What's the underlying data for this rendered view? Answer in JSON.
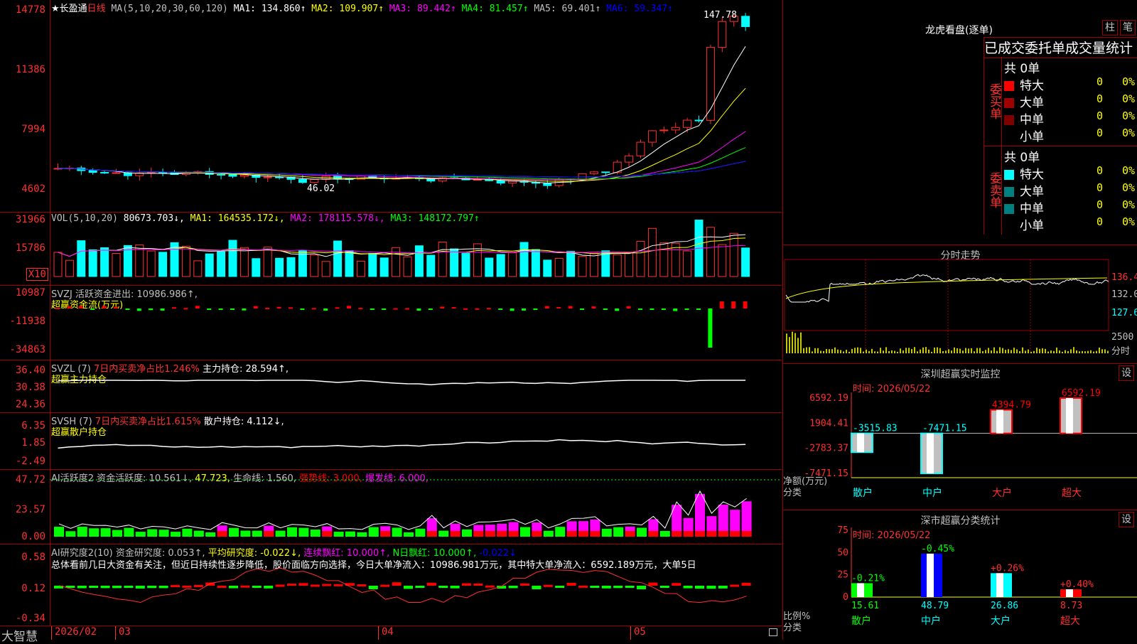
{
  "main": {
    "title": "★长盈通",
    "period": "日线",
    "ma_params": "MA(5,10,20,30,60,120)",
    "ma": [
      {
        "label": "MA1: 134.860↑",
        "color": "#ffffff"
      },
      {
        "label": "MA2: 109.907↑",
        "color": "#ffff00"
      },
      {
        "label": "MA3: 89.442↑",
        "color": "#ff00ff"
      },
      {
        "label": "MA4: 81.457↑",
        "color": "#00ff00"
      },
      {
        "label": "MA5: 69.401↑",
        "color": "#c0c0c0"
      },
      {
        "label": "MA6: 59.347↑",
        "color": "#0000ff"
      }
    ],
    "axis": [
      "14778",
      "11386",
      "7994",
      "4602"
    ],
    "high_label": "147.78",
    "low_label": "46.02"
  },
  "vol": {
    "header": [
      {
        "label": "VOL(5,10,20)",
        "color": "#c0c0c0"
      },
      {
        "label": "80673.703↓,",
        "color": "#ffffff"
      },
      {
        "label": "MA1: 164535.172↓,",
        "color": "#ffff00"
      },
      {
        "label": "MA2: 178115.578↓,",
        "color": "#ff00ff"
      },
      {
        "label": "MA3: 148172.797↑",
        "color": "#00ff00"
      }
    ],
    "axis": [
      "31966",
      "15786"
    ],
    "unit": "X10"
  },
  "svzj": {
    "header": "SVZJ  活跃资金进出: 10986.986↑,",
    "sub": "超赢资金流(万元)",
    "axis": [
      "10987",
      "-11938",
      "-34863"
    ]
  },
  "svzl": {
    "header_a": "SVZL (7)",
    "header_b": "7日内买卖净占比1.246%",
    "header_c": "主力持仓: 28.594↑,",
    "sub": "超赢主力持仓",
    "axis": [
      "36.40",
      "30.38",
      "24.36"
    ]
  },
  "svsh": {
    "header_a": "SVSH (7)",
    "header_b": "7日内买卖净占比1.615%",
    "header_c": "散户持仓: 4.112↓,",
    "sub": "超赢散户持仓",
    "axis": [
      "6.35",
      "1.85",
      "-2.49"
    ]
  },
  "ai1": {
    "header": [
      {
        "label": "AI活跃度2 资金活跃度: 10.561↓,",
        "color": "#c0c0c0"
      },
      {
        "label": "47.723,",
        "color": "#ffff00"
      },
      {
        "label": "生命线: 1.560,",
        "color": "#c0c0c0"
      },
      {
        "label": "强势线: 3.000,",
        "color": "#ff0000"
      },
      {
        "label": "爆发线: 6.000,",
        "color": "#ff00ff"
      }
    ],
    "axis": [
      "47.72",
      "23.57",
      "0.00"
    ]
  },
  "ai2": {
    "header": [
      {
        "label": "AI研究度2(10) 资金研究度: 0.053↑,",
        "color": "#c0c0c0"
      },
      {
        "label": "平均研究度: -0.022↓,",
        "color": "#ffff00"
      },
      {
        "label": "连续飘红: 10.000↑,",
        "color": "#ff00ff"
      },
      {
        "label": "N日飘红: 10.000↑,",
        "color": "#00ff00"
      },
      {
        "label": "-0.022↓",
        "color": "#0000ff"
      }
    ],
    "comment": "总体看前几日大资金有关注，但近日持续性逐步降低，股价面临方向选择，今日大单净流入：10986.981万元，其中特大单净流入：6592.189万元，大单5日",
    "axis": [
      "0.58",
      "0.12",
      "-0.34"
    ]
  },
  "bottom": {
    "brand": "大智慧",
    "dates": [
      "2026/02",
      "03",
      "04",
      "05"
    ]
  },
  "lhb": {
    "title": "龙虎看盘(逐单)",
    "btn1": "柱",
    "btn2": "笔",
    "stat_title": "已成交委托单成交量统计",
    "buy_label": "委买单",
    "sell_label": "委卖单",
    "buy_total": "共 0单",
    "sell_total": "共 0单",
    "buy_rows": [
      {
        "name": "特大",
        "count": "0",
        "pct": "0%",
        "color": "#ff0000"
      },
      {
        "name": "大单",
        "count": "0",
        "pct": "0%",
        "color": "#a00000"
      },
      {
        "name": "中单",
        "count": "0",
        "pct": "0%",
        "color": "#800000"
      },
      {
        "name": "小单",
        "count": "0",
        "pct": "0%",
        "color": "#000000"
      }
    ],
    "sell_rows": [
      {
        "name": "特大",
        "count": "0",
        "pct": "0%",
        "color": "#00ffff"
      },
      {
        "name": "大单",
        "count": "0",
        "pct": "0%",
        "color": "#008080"
      },
      {
        "name": "中单",
        "count": "0",
        "pct": "0%",
        "color": "#008080"
      },
      {
        "name": "小单",
        "count": "0",
        "pct": "0%",
        "color": "#000000"
      }
    ]
  },
  "fenshi": {
    "title": "分时走势",
    "axis": [
      "136.4",
      "132.0",
      "127.6"
    ],
    "vol_axis": "2500",
    "vol_unit": "分时"
  },
  "sz_monitor": {
    "title": "深圳超赢实时监控",
    "btn": "设",
    "time": "时间: 2026/05/22",
    "axis": [
      "6592.19",
      "1904.41",
      "-2783.37",
      "-7471.15"
    ],
    "unit": "净额(万元)",
    "cat_label": "分类",
    "categories": [
      "散户",
      "中户",
      "大户",
      "超大"
    ],
    "values": [
      -3515.83,
      -7471.15,
      4394.79,
      6592.19
    ],
    "value_labels": [
      "-3515.83",
      "-7471.15",
      "4394.79",
      "6592.19"
    ]
  },
  "sz_class": {
    "title": "深市超赢分类统计",
    "btn": "设",
    "time": "时间: 2026/05/22",
    "axis": [
      "75",
      "50",
      "25",
      "0"
    ],
    "unit": "比例%",
    "cat_label": "分类",
    "categories": [
      "散户",
      "中户",
      "大户",
      "超大"
    ],
    "values": [
      15.61,
      48.79,
      26.86,
      8.73
    ],
    "value_labels": [
      "15.61",
      "48.79",
      "26.86",
      "8.73"
    ],
    "changes": [
      "-0.21%",
      "-0.45%",
      "+0.26%",
      "+0.40%"
    ]
  }
}
